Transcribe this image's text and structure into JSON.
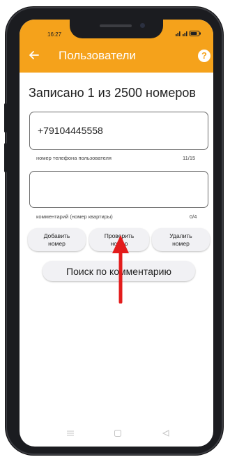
{
  "status_bar": {
    "time": "16:27"
  },
  "app_bar": {
    "title": "Пользователи",
    "back_icon": "arrow-left-icon",
    "help_icon": "question-circle-icon",
    "help_glyph": "?"
  },
  "main": {
    "headline": "Записано 1 из 2500 номеров",
    "phone_field": {
      "value": "+79104445558",
      "helper": "номер телефона пользователя",
      "counter": "11/15"
    },
    "comment_field": {
      "value": "",
      "helper": "комментарий (номер квартиры)",
      "counter": "0/4"
    },
    "buttons": {
      "add": "Добавить\nномер",
      "check": "Проверить\nномер",
      "delete": "Удалить\nномер",
      "search": "Поиск по комментарию"
    }
  },
  "nav_bar": {
    "icons": [
      "menu-icon",
      "home-square-icon",
      "back-triangle-icon"
    ]
  },
  "colors": {
    "accent": "#f5a21b",
    "arrow": "#e31c1c"
  }
}
